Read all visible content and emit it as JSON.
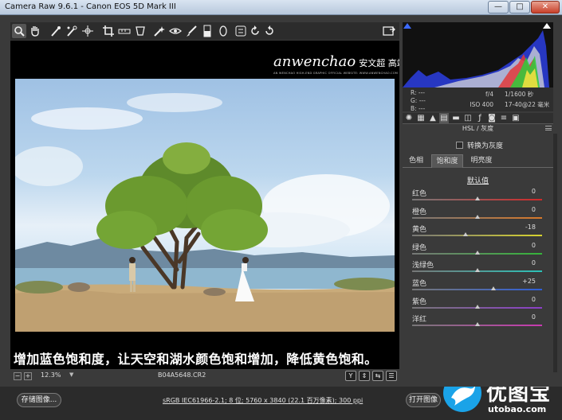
{
  "window": {
    "title": "Camera Raw 9.6.1 -  Canon EOS 5D Mark III",
    "min": "—",
    "max": "□",
    "close": "✕"
  },
  "toolbar": {
    "tools": [
      "zoom-icon",
      "hand-icon",
      "white-balance-icon",
      "color-sampler-icon",
      "target-adjust-icon",
      "crop-icon",
      "straighten-icon",
      "transform-icon",
      "spot-removal-icon",
      "red-eye-icon",
      "adjustment-brush-icon",
      "graduated-filter-icon",
      "radial-filter-icon",
      "rotate-left-icon",
      "rotate-right-icon",
      "preferences-icon"
    ]
  },
  "preview": {
    "brand_latin": "anwenchao",
    "brand_cn": "安文超 高端修图",
    "brand_sub": "AN WENCHAO HIGH-END GRAPHIC OFFICIAL WEBSITE: WWW.ANWENCHAO.COM",
    "caption": "增加蓝色饱和度，让天空和湖水颜色饱和增加，降低黄色饱和。"
  },
  "status": {
    "zoom_out": "−",
    "zoom_in": "+",
    "zoom": "12.3%",
    "zoom_arrow": "▼",
    "filename": "B04A5648.CR2",
    "view_buttons": [
      "Y",
      "⇕",
      "⇆",
      "☰"
    ]
  },
  "bottom": {
    "save": "存储图像...",
    "workflow": "sRGB IEC61966-2.1; 8 位; 5760 x 3840 (22.1 百万像素); 300 ppi",
    "open": "打开图像"
  },
  "watermark": {
    "cn": "优图宝",
    "url": "utobao.com"
  },
  "info": {
    "r": "R:  ---",
    "g": "G:  ---",
    "b": "B:  ---",
    "aperture": "f/4",
    "shutter": "1/1600 秒",
    "iso": "ISO 400",
    "lens": "17-40@22 毫米"
  },
  "panel": {
    "tab_icons": [
      "aperture-icon",
      "tone-curve-icon",
      "mountain-icon",
      "hsl-icon",
      "split-tone-icon",
      "lens-icon",
      "fx-icon",
      "camera-icon",
      "presets-icon",
      "snapshots-icon"
    ],
    "title": "HSL / 灰度",
    "grayscale": "转换为灰度",
    "subtabs": [
      "色相",
      "饱和度",
      "明亮度"
    ],
    "active_subtab": "饱和度",
    "default": "默认值",
    "sliders": [
      {
        "label": "红色",
        "value": "0",
        "color": "#d02a2a",
        "pos": 0.5
      },
      {
        "label": "橙色",
        "value": "0",
        "color": "#d7782a",
        "pos": 0.5
      },
      {
        "label": "黄色",
        "value": "-18",
        "color": "#d8d32e",
        "pos": 0.41
      },
      {
        "label": "绿色",
        "value": "0",
        "color": "#35b43a",
        "pos": 0.5
      },
      {
        "label": "浅绿色",
        "value": "0",
        "color": "#2bc2b8",
        "pos": 0.5
      },
      {
        "label": "蓝色",
        "value": "+25",
        "color": "#2f5fd8",
        "pos": 0.625
      },
      {
        "label": "紫色",
        "value": "0",
        "color": "#8b3fc8",
        "pos": 0.5
      },
      {
        "label": "洋红",
        "value": "0",
        "color": "#c83ab0",
        "pos": 0.5
      }
    ]
  },
  "colors": {
    "accent_blue": "#1aa3e8",
    "panel_bg": "#3a3a3a"
  }
}
